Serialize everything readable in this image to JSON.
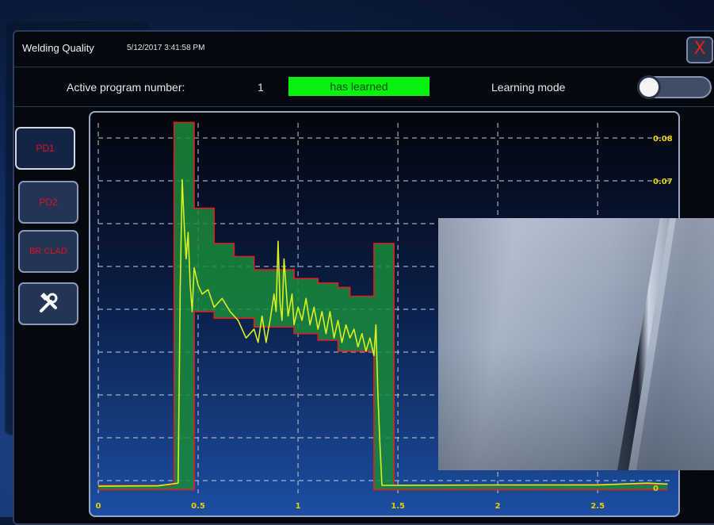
{
  "window": {
    "title": "Welding Quality",
    "timestamp": "5/12/2017 3:41:58 PM",
    "close_glyph": "X"
  },
  "status": {
    "program_label": "Active program number:",
    "program_number": "1",
    "learned_badge": "has learned",
    "learning_mode_label": "Learning mode",
    "learning_mode_on": false
  },
  "tabs": [
    {
      "label": "PD1",
      "active": true
    },
    {
      "label": "PD2",
      "active": false
    },
    {
      "label": "BR CLAD",
      "active": false
    },
    {
      "label": "",
      "icon": "tools-icon"
    }
  ],
  "colors": {
    "accent_green": "#08f00e",
    "envelope_fill": "#1a8a3c",
    "envelope_edge": "#e02020",
    "signal": "#d8f020",
    "axis_label": "#e8d000",
    "tab_text": "#e01020"
  },
  "chart_data": {
    "type": "line",
    "x_ticks": [
      "0",
      "0.5",
      "1",
      "1.5",
      "2",
      "2.5"
    ],
    "y_ticks": [
      "0",
      "0.07",
      "0.08"
    ],
    "xlim": [
      0,
      2.88
    ],
    "ylim": [
      -0.0013,
      0.0829
    ],
    "series": [
      {
        "role": "upper-envelope",
        "x": [
          0,
          0.38,
          0.38,
          0.48,
          0.48,
          0.58,
          0.58,
          0.68,
          0.68,
          0.78,
          0.78,
          0.98,
          0.98,
          1.1,
          1.1,
          1.2,
          1.2,
          1.26,
          1.26,
          1.38,
          1.38,
          1.48,
          1.48,
          2.0,
          2.75,
          2.85
        ],
        "y": [
          0.0005,
          0.0005,
          0.083,
          0.083,
          0.0635,
          0.0635,
          0.0555,
          0.0555,
          0.0525,
          0.0525,
          0.0495,
          0.0495,
          0.0475,
          0.0475,
          0.0465,
          0.0465,
          0.0455,
          0.0455,
          0.0435,
          0.0435,
          0.0555,
          0.0555,
          0.0005,
          0.0005,
          0.0008,
          0.0008
        ]
      },
      {
        "role": "lower-envelope",
        "x": [
          0,
          0.38,
          0.38,
          0.48,
          0.48,
          0.58,
          0.58,
          0.78,
          0.78,
          0.98,
          0.98,
          1.1,
          1.1,
          1.2,
          1.2,
          1.38,
          1.38,
          1.48,
          1.48,
          2.0,
          2.75,
          2.85
        ],
        "y": [
          -0.0005,
          -0.0005,
          -0.0005,
          -0.0005,
          0.04,
          0.04,
          0.0385,
          0.0385,
          0.0365,
          0.0365,
          0.035,
          0.035,
          0.0335,
          0.0335,
          0.031,
          0.031,
          -0.0005,
          -0.0005,
          -0.0005,
          -0.0005,
          -0.0005,
          -0.0005
        ]
      },
      {
        "role": "measured-signal",
        "x": [
          0,
          0.3,
          0.4,
          0.41,
          0.42,
          0.43,
          0.44,
          0.45,
          0.46,
          0.47,
          0.48,
          0.5,
          0.52,
          0.55,
          0.58,
          0.62,
          0.66,
          0.7,
          0.74,
          0.78,
          0.8,
          0.82,
          0.84,
          0.86,
          0.88,
          0.89,
          0.9,
          0.91,
          0.92,
          0.93,
          0.95,
          0.97,
          0.98,
          1.0,
          1.02,
          1.04,
          1.06,
          1.08,
          1.1,
          1.12,
          1.14,
          1.16,
          1.18,
          1.2,
          1.22,
          1.24,
          1.26,
          1.28,
          1.3,
          1.32,
          1.34,
          1.36,
          1.38,
          1.39,
          1.4,
          1.41,
          1.42,
          1.5,
          2.0,
          2.5,
          2.75,
          2.85
        ],
        "y": [
          0.0003,
          0.0004,
          0.001,
          0.045,
          0.07,
          0.06,
          0.052,
          0.058,
          0.046,
          0.04,
          0.05,
          0.046,
          0.044,
          0.045,
          0.041,
          0.043,
          0.04,
          0.038,
          0.034,
          0.036,
          0.033,
          0.039,
          0.033,
          0.038,
          0.044,
          0.04,
          0.056,
          0.042,
          0.038,
          0.052,
          0.039,
          0.044,
          0.037,
          0.041,
          0.038,
          0.043,
          0.037,
          0.041,
          0.036,
          0.04,
          0.035,
          0.04,
          0.034,
          0.038,
          0.033,
          0.037,
          0.034,
          0.036,
          0.032,
          0.035,
          0.031,
          0.034,
          0.03,
          0.037,
          0.021,
          0.01,
          0.0005,
          0.0005,
          0.0006,
          0.0006,
          0.001,
          0.0008
        ]
      }
    ]
  },
  "photo": {
    "description_icon": "weld-seam-photo"
  }
}
